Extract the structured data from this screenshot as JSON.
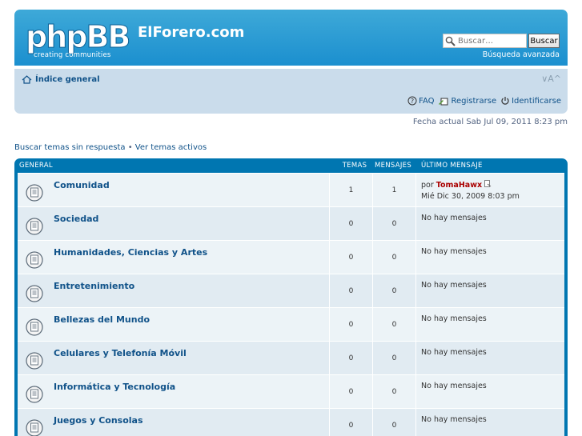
{
  "header": {
    "logo_text": "phpBB",
    "logo_tagline": "creating communities",
    "site_title": "ElForero.com",
    "search_placeholder": "Buscar…",
    "search_button": "Buscar",
    "advanced_search": "Búsqueda avanzada"
  },
  "nav": {
    "home": "Índice general",
    "font_size": "∨A^",
    "faq": "FAQ",
    "register": "Registrarse",
    "login": "Identificarse"
  },
  "date_text": "Fecha actual Sab Jul 09, 2011 8:23 pm",
  "quick_links": {
    "unanswered": "Buscar temas sin respuesta",
    "separator": "•",
    "active": "Ver temas activos"
  },
  "forum_table": {
    "headers": {
      "name": "GENERAL",
      "topics": "TEMAS",
      "posts": "MENSAJES",
      "last": "ÚLTIMO MENSAJE"
    },
    "rows": [
      {
        "name": "Comunidad",
        "topics": "1",
        "posts": "1",
        "last_prefix": "por",
        "last_author": "TomaHawx",
        "last_date": "Mié Dic 30, 2009 8:03 pm"
      },
      {
        "name": "Sociedad",
        "topics": "0",
        "posts": "0",
        "last_text": "No hay mensajes"
      },
      {
        "name": "Humanidades, Ciencias y Artes",
        "topics": "0",
        "posts": "0",
        "last_text": "No hay mensajes"
      },
      {
        "name": "Entretenimiento",
        "topics": "0",
        "posts": "0",
        "last_text": "No hay mensajes"
      },
      {
        "name": "Bellezas del Mundo",
        "topics": "0",
        "posts": "0",
        "last_text": "No hay mensajes"
      },
      {
        "name": "Celulares y Telefonía Móvil",
        "topics": "0",
        "posts": "0",
        "last_text": "No hay mensajes"
      },
      {
        "name": "Informática y Tecnología",
        "topics": "0",
        "posts": "0",
        "last_text": "No hay mensajes"
      },
      {
        "name": "Juegos y Consolas",
        "topics": "0",
        "posts": "0",
        "last_text": "No hay mensajes"
      }
    ]
  }
}
